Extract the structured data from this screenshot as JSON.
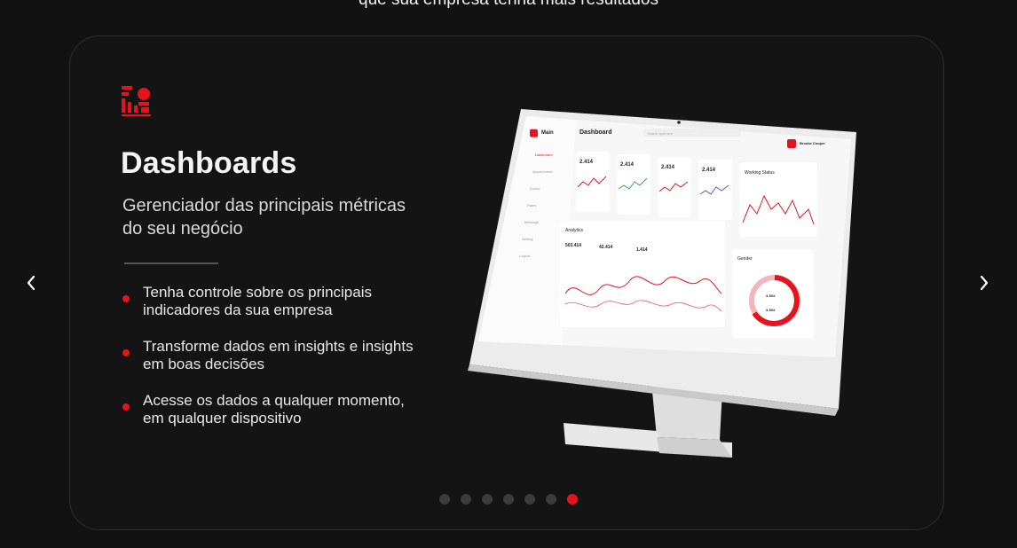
{
  "header": {
    "subtitle": "que sua empresa tenha mais resultados"
  },
  "slide": {
    "icon": "dashboard-chart-icon",
    "title": "Dashboards",
    "description": "Gerenciador das principais métricas do seu negócio",
    "bullets": [
      "Tenha controle sobre os principais indicadores da sua empresa",
      "Transforme dados em insights e insights em boas decisões",
      "Acesse os dados a qualquer momento, em qualquer dispositivo"
    ]
  },
  "mockup": {
    "brand": "Main",
    "page_title": "Dashboard",
    "search_placeholder": "Search input here",
    "user_name": "Brooke Cooper",
    "menu": [
      "Dashboard",
      "Appointment",
      "Doctor",
      "Rates",
      "Message",
      "Setting",
      "Logout"
    ],
    "stats": [
      "2.414",
      "2.414",
      "2.414",
      "2.414"
    ],
    "working_status_title": "Working Status",
    "analytics_title": "Analytics",
    "analytics_values": [
      "503.414",
      "42.414",
      "1.414"
    ],
    "gender_title": "Gender",
    "gender_values": [
      "3.354",
      "3.354"
    ]
  },
  "carousel": {
    "total": 7,
    "active_index": 6,
    "prev_icon": "chevron-left-icon",
    "next_icon": "chevron-right-icon"
  },
  "colors": {
    "accent": "#e3141e",
    "background": "#121212",
    "dot_inactive": "#3b3b3b"
  }
}
